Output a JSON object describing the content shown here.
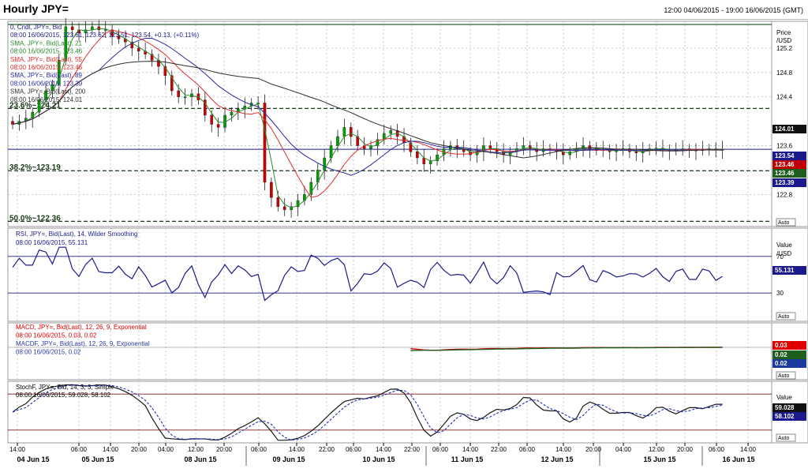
{
  "header": {
    "title": "Hourly JPY=",
    "range": "12:00 04/06/2015 - 19:00 16/06/2015 (GMT)"
  },
  "colors": {
    "candle_up": "#00a000",
    "candle_down": "#d00000",
    "sma21": "#2e8b2e",
    "sma55": "#e03030",
    "sma89": "#2a2aa0",
    "sma200": "#303030",
    "rsi": "#1a1a8c",
    "macd": "#e00000",
    "signal": "#1e5e1e",
    "hist": "#2a3aa0",
    "stoch_k": "#1a1a1a",
    "stoch_d": "#2030c0"
  },
  "price_panel": {
    "legend": [
      "0, Cndl, JPY=, Bid",
      "08:00 16/06/2015, 123.61, 123.62, 123.51, 123.54, +0.13, (+0.11%)",
      "SMA, JPY=, Bid(Last), 21",
      "08:00 16/06/2015, 123.46",
      "SMA, JPY=, Bid(Last), 55",
      "08:00 16/06/2015, 123.46",
      "SMA, JPY=, Bid(Last), 89",
      "08:00 16/06/2015, 123.39",
      "SMA, JPY=, Bid(Last), 200",
      "08:00 16/06/2015, 124.01"
    ],
    "axis_title": [
      "Price",
      "/USD"
    ],
    "fib_labels": [
      "23.6%~124.21",
      "38.2%~123.19",
      "50.0%~122.36"
    ],
    "ticks": [
      "125.2",
      "124.8",
      "124.4",
      "123.6",
      "122.8"
    ],
    "value_boxes": [
      "124.01",
      "123.54",
      "123.46",
      "123.46",
      "123.39"
    ],
    "auto": "Auto"
  },
  "rsi_panel": {
    "legend": [
      "RSI, JPY=, Bid(Last), 14, Wilder Smoothing",
      "08:00 16/06/2015, 55.131"
    ],
    "axis_title": [
      "Value",
      "/USD"
    ],
    "ticks": [
      "70",
      "30"
    ],
    "value_box": "55.131",
    "auto": "Auto"
  },
  "macd_panel": {
    "legend": [
      "MACD, JPY=, Bid(Last), 12, 26, 9, Exponential",
      "08:00 16/06/2015, 0.03, 0.02",
      "MACDF, JPY=, Bid(Last), 12, 26, 9, Exponential",
      "08:00 16/06/2015, 0.02"
    ],
    "value_boxes": [
      "0.03",
      "0.02",
      "0.02"
    ],
    "auto": "Auto"
  },
  "stoch_panel": {
    "legend": [
      "StochF, JPY=, Bid, 14, 3, 3, Simple",
      "08:00 16/06/2015, 59.028, 58.102"
    ],
    "axis_title": "Value",
    "value_boxes": [
      "59.028",
      "58.102"
    ],
    "auto": "Auto"
  },
  "x_axis": {
    "time_ticks": [
      "14:00",
      "06:00",
      "14:00",
      "20:00",
      "04:00",
      "12:00",
      "20:00",
      "06:00",
      "14:00",
      "22:00",
      "06:00",
      "14:00",
      "22:00",
      "06:00",
      "14:00",
      "22:00",
      "06:00",
      "14:00",
      "20:00",
      "04:00",
      "12:00",
      "20:00",
      "06:00",
      "14:00"
    ],
    "date_labels": [
      "04 Jun 15",
      "05 Jun 15",
      "08 Jun 15",
      "09 Jun 15",
      "10 Jun 15",
      "11 Jun 15",
      "12 Jun 15",
      "15 Jun 15",
      "16 Jun 15"
    ]
  },
  "chart_data": [
    {
      "type": "line",
      "name": "JPY= hourly candlestick with SMA 21/55/89/200",
      "title": "Hourly JPY=",
      "ylabel": "Price /USD",
      "ylim": [
        122.3,
        125.6
      ],
      "fib_levels": [
        {
          "label": "23.6%~124.21",
          "value": 124.21
        },
        {
          "label": "38.2%~123.19",
          "value": 123.19
        },
        {
          "label": "50.0%~122.36",
          "value": 122.36
        }
      ],
      "horizontal_line": 123.54,
      "series": [
        {
          "name": "Close",
          "x": [
            0,
            2,
            4,
            6,
            8,
            10,
            12,
            14,
            16,
            18,
            20,
            22,
            24,
            26,
            28,
            30,
            32,
            34,
            36,
            38,
            40,
            42,
            44,
            46,
            48,
            50,
            52,
            54,
            56,
            58,
            60,
            62,
            64,
            66,
            68,
            70,
            72,
            74,
            76,
            78,
            80,
            82,
            84,
            86,
            88,
            90,
            92,
            94,
            96,
            98,
            100,
            102,
            104,
            106,
            108,
            110,
            112,
            114,
            116,
            118,
            120,
            122,
            124,
            126,
            128,
            130,
            132,
            134,
            136,
            138,
            140,
            142,
            144,
            146,
            148,
            150,
            152,
            154,
            156,
            158,
            160,
            162,
            164,
            166,
            168,
            170,
            172,
            174,
            176,
            178,
            180,
            182,
            184,
            186,
            188,
            190,
            192,
            194,
            196,
            198,
            200,
            202,
            204,
            206,
            208,
            210,
            212,
            214
          ],
          "values": [
            123.95,
            124.0,
            124.05,
            124.15,
            124.35,
            124.5,
            124.6,
            125.0,
            125.55,
            125.5,
            125.45,
            125.5,
            125.55,
            125.5,
            125.5,
            125.4,
            125.35,
            125.3,
            125.2,
            125.15,
            125.1,
            125.0,
            124.9,
            124.75,
            124.5,
            124.4,
            124.4,
            124.45,
            124.35,
            124.1,
            123.95,
            123.9,
            124.1,
            124.15,
            124.2,
            124.25,
            124.3,
            124.3,
            123.0,
            122.75,
            122.6,
            122.55,
            122.6,
            122.7,
            122.8,
            123.0,
            123.2,
            123.4,
            123.6,
            123.75,
            123.9,
            123.75,
            123.6,
            123.55,
            123.6,
            123.7,
            123.8,
            123.85,
            123.75,
            123.65,
            123.5,
            123.4,
            123.3,
            123.35,
            123.45,
            123.55,
            123.6,
            123.55,
            123.5,
            123.45,
            123.5,
            123.6,
            123.55,
            123.5,
            123.45,
            123.5,
            123.55,
            123.6,
            123.55,
            123.5,
            123.55,
            123.54,
            123.5,
            123.45,
            123.5,
            123.55,
            123.6,
            123.55,
            123.52,
            123.54,
            123.5,
            123.52,
            123.55,
            123.5,
            123.48,
            123.52,
            123.55,
            123.56,
            123.54,
            123.52,
            123.54,
            123.55,
            123.53,
            123.52,
            123.54,
            123.55,
            123.54,
            123.54
          ]
        },
        {
          "name": "SMA 21",
          "values_end": 123.46
        },
        {
          "name": "SMA 55",
          "values_end": 123.46
        },
        {
          "name": "SMA 89",
          "values_end": 123.39
        },
        {
          "name": "SMA 200",
          "values_end": 124.01
        }
      ]
    },
    {
      "type": "line",
      "name": "RSI 14",
      "ylim": [
        0,
        100
      ],
      "levels": [
        70,
        30
      ],
      "last": 55.131
    },
    {
      "type": "line",
      "name": "MACD 12,26,9",
      "last": [
        0.03,
        0.02
      ],
      "histogram_last": 0.02
    },
    {
      "type": "line",
      "name": "StochF 14,3,3",
      "ylim": [
        0,
        100
      ],
      "last": [
        59.028,
        58.102
      ]
    }
  ]
}
